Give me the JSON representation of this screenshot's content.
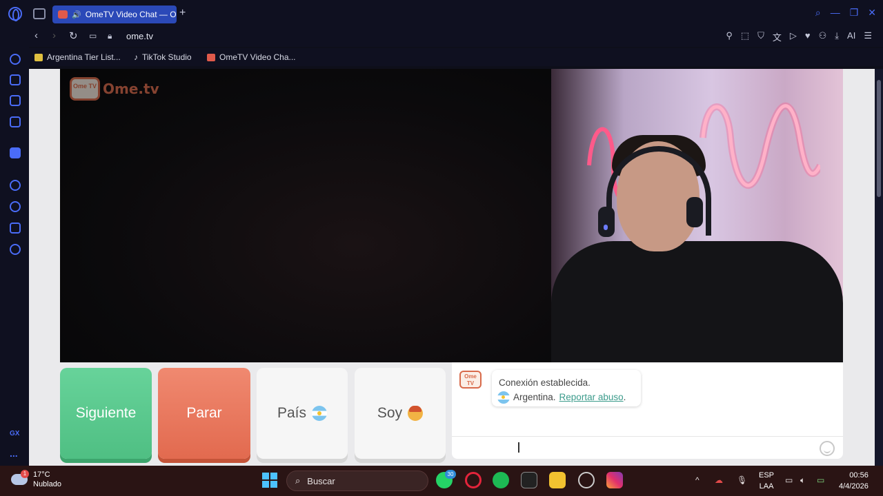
{
  "browser": {
    "tab_title": "OmeTV Video Chat — O",
    "new_tab": "+",
    "url": "ome.tv",
    "ai_label": "AI",
    "bookmarks": [
      {
        "label": "Argentina Tier List..."
      },
      {
        "label": "TikTok Studio"
      },
      {
        "label": "OmeTV Video Cha..."
      }
    ],
    "sidebar_gx": "GX",
    "sidebar_more": "..."
  },
  "page": {
    "logo_tv": "Ome TV",
    "logo_word": "Ome.tv",
    "buttons": {
      "next": "Siguiente",
      "stop": "Parar",
      "country": "País",
      "gender": "Soy"
    },
    "chat": {
      "avatar": "Ome TV",
      "status": "Conexión establecida.",
      "country": "Argentina.",
      "report": "Reportar abuso",
      "report_suffix": "."
    }
  },
  "taskbar": {
    "temperature": "17°C",
    "weather": "Nublado",
    "weather_badge": "1",
    "search_placeholder": "Buscar",
    "whatsapp_badge": "30",
    "lang_top": "ESP",
    "lang_bottom": "LAA",
    "time": "00:56",
    "date": "4/4/2026"
  },
  "colors": {
    "tab_active": "#2b49b8",
    "next_button": "#4fbf83",
    "stop_button": "#e26a4f",
    "link": "#3b9b8b",
    "brand": "#d86a4a"
  }
}
